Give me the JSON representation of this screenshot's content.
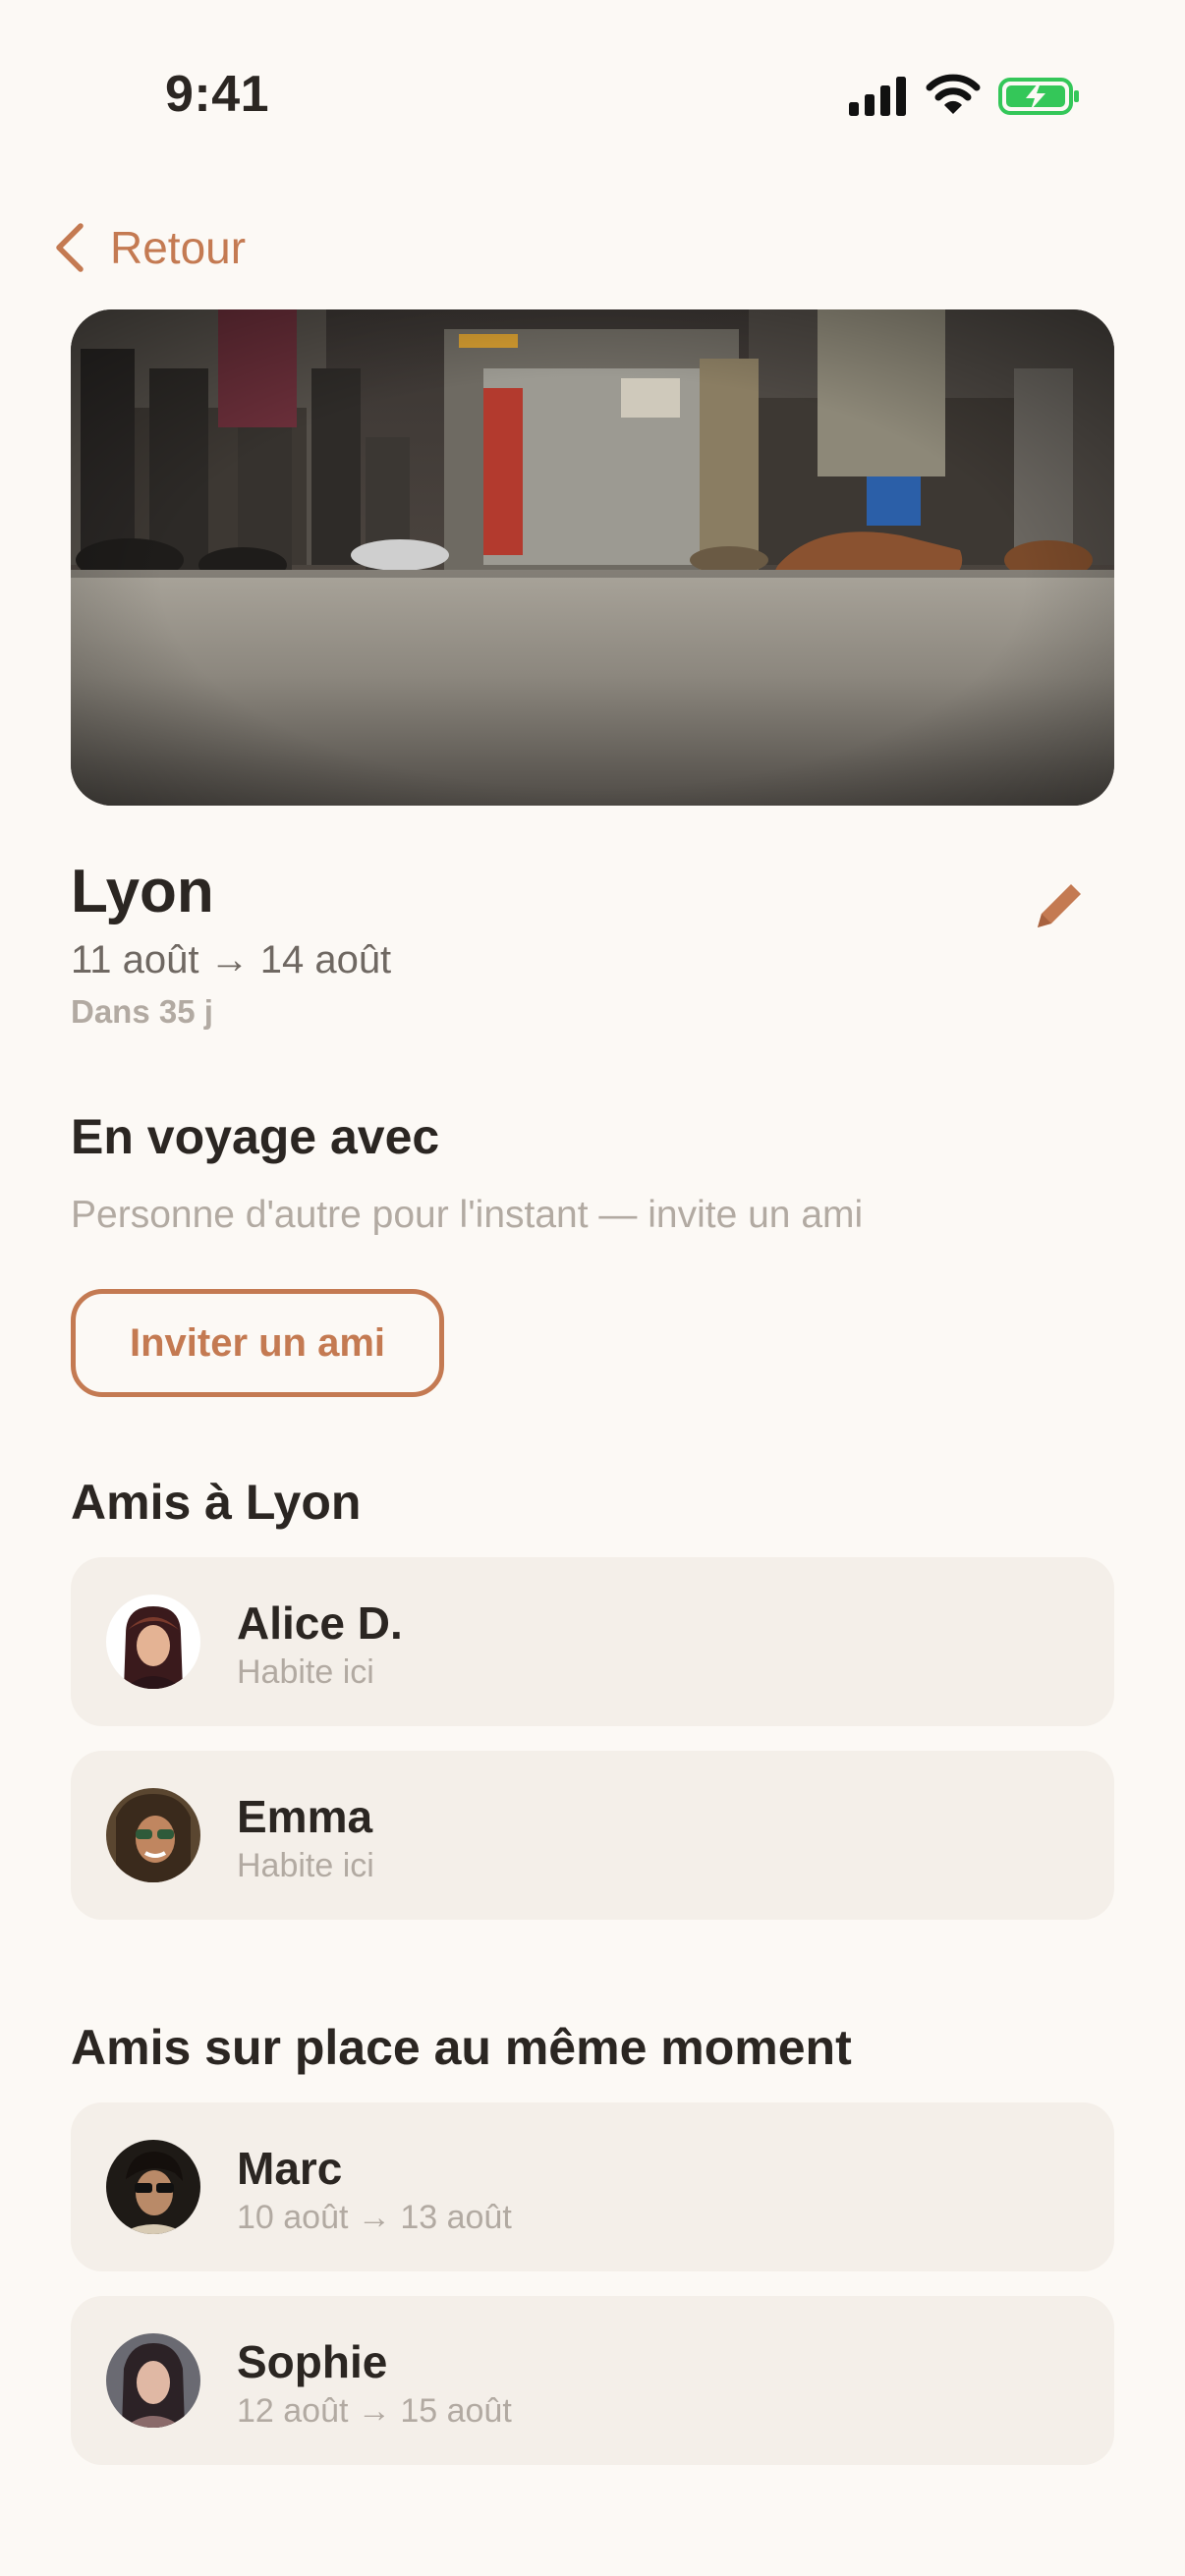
{
  "status_bar": {
    "time": "9:41"
  },
  "nav": {
    "back_label": "Retour"
  },
  "trip": {
    "city": "Lyon",
    "dates": "11 août → 14 août",
    "countdown": "Dans 35 j"
  },
  "travel_with": {
    "title": "En voyage avec",
    "empty_text": "Personne d'autre pour l'instant — invite un ami",
    "invite_label": "Inviter un ami"
  },
  "friends_in_city": {
    "title": "Amis à Lyon",
    "items": [
      {
        "name": "Alice D.",
        "subtitle": "Habite ici"
      },
      {
        "name": "Emma",
        "subtitle": "Habite ici"
      }
    ]
  },
  "friends_same_time": {
    "title": "Amis sur place au même moment",
    "items": [
      {
        "name": "Marc",
        "subtitle": "10 août → 13 août"
      },
      {
        "name": "Sophie",
        "subtitle": "12 août → 15 août"
      }
    ]
  },
  "colors": {
    "accent": "#C47A52",
    "background": "#FCF9F5",
    "card": "#F4EFE9",
    "text_primary": "#2B2622",
    "text_muted": "#B2AAA2",
    "battery_green": "#34C759"
  },
  "icons": {
    "back": "chevron-left-icon",
    "edit": "pencil-icon",
    "signal": "cellular-signal-icon",
    "wifi": "wifi-icon",
    "battery": "battery-charging-icon"
  }
}
